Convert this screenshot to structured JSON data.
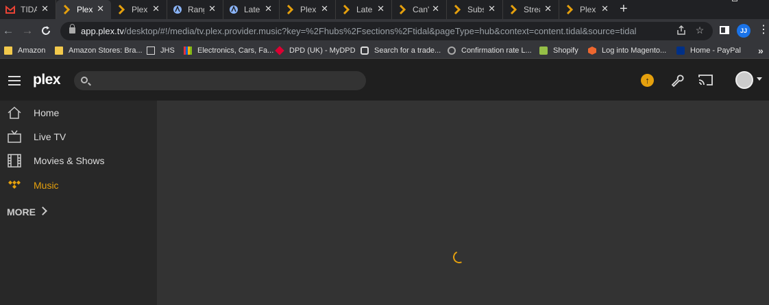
{
  "tabs": [
    {
      "label": "TIDA",
      "icon": "gmail-icon"
    },
    {
      "label": "Plex",
      "icon": "plex-icon"
    },
    {
      "label": "Plex",
      "icon": "plex-icon"
    },
    {
      "label": "Rang",
      "icon": "forum-icon"
    },
    {
      "label": "Lates",
      "icon": "forum-icon"
    },
    {
      "label": "Plex",
      "icon": "plex-icon"
    },
    {
      "label": "Lates",
      "icon": "plex-icon"
    },
    {
      "label": "Can't",
      "icon": "plex-icon"
    },
    {
      "label": "Subs",
      "icon": "plex-icon"
    },
    {
      "label": "Strea",
      "icon": "plex-icon"
    },
    {
      "label": "Plex",
      "icon": "plex-icon"
    }
  ],
  "new_tab_label": "+",
  "address": {
    "host": "app.plex.tv",
    "path": "/desktop/#!/media/tv.plex.provider.music?key=%2Fhubs%2Fsections%2Ftidal&pageType=hub&context=content.tidal&source=tidal"
  },
  "profile_initials": "JJ",
  "bookmarks": [
    {
      "label": "Amazon",
      "icon": "folder-icon"
    },
    {
      "label": "Amazon Stores: Bra...",
      "icon": "folder-icon"
    },
    {
      "label": "JHS",
      "icon": "jhs-icon"
    },
    {
      "label": "Electronics, Cars, Fa...",
      "icon": "ebay-icon"
    },
    {
      "label": "DPD (UK) - MyDPD",
      "icon": "dpd-icon"
    },
    {
      "label": "Search for a trade...",
      "icon": "trade-icon"
    },
    {
      "label": "Confirmation rate L...",
      "icon": "globe-icon"
    },
    {
      "label": "Shopify",
      "icon": "shopify-icon"
    },
    {
      "label": "Log into Magento...",
      "icon": "magento-icon"
    },
    {
      "label": "Home - PayPal",
      "icon": "paypal-icon"
    }
  ],
  "app": {
    "logo": "plex",
    "search_placeholder": "",
    "sidebar": [
      {
        "label": "Home",
        "icon": "home-icon",
        "active": false
      },
      {
        "label": "Live TV",
        "icon": "tv-icon",
        "active": false
      },
      {
        "label": "Movies & Shows",
        "icon": "film-icon",
        "active": false
      },
      {
        "label": "Music",
        "icon": "tidal-icon",
        "active": true
      }
    ],
    "more_label": "MORE",
    "accent": "#e5a00d"
  }
}
